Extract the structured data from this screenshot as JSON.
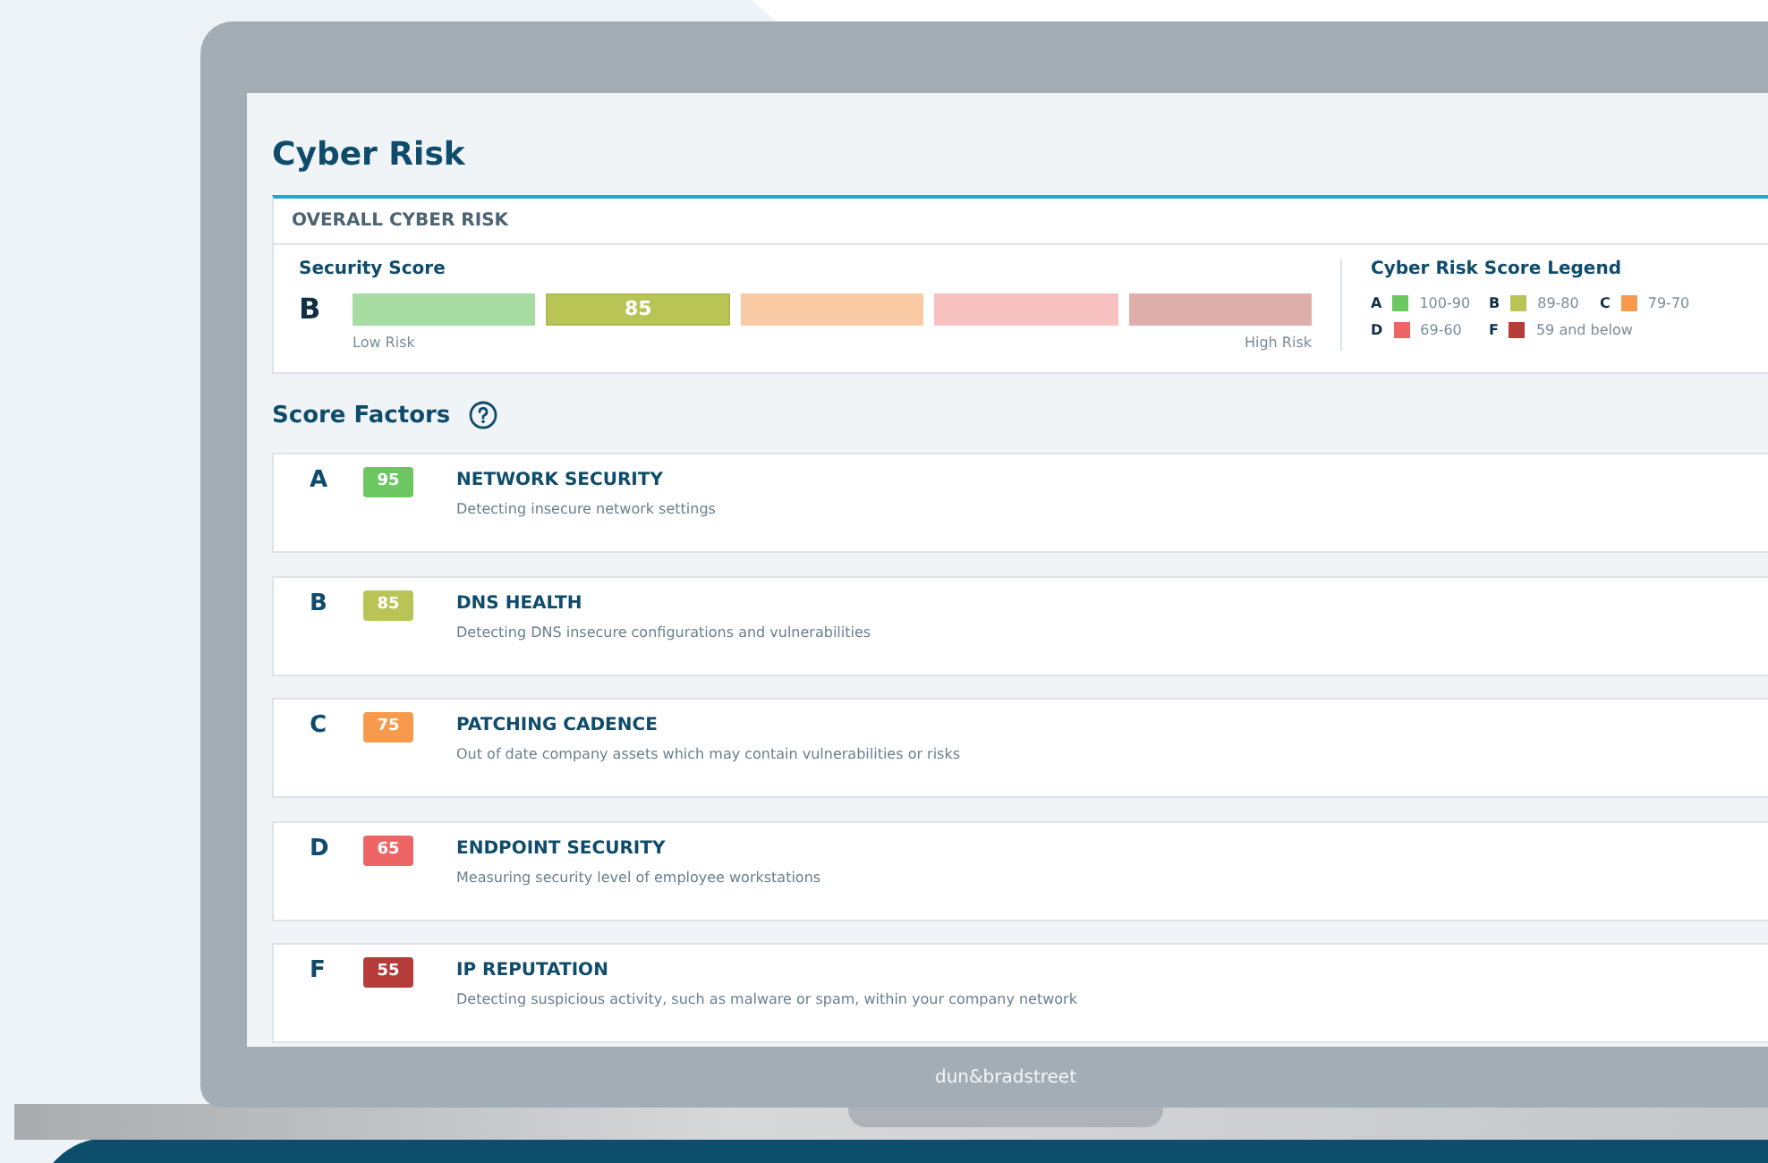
{
  "page": {
    "title": "Cyber Risk"
  },
  "overall": {
    "header": "OVERALL CYBER RISK",
    "score_label": "Security Score",
    "grade": "B",
    "low_label": "Low Risk",
    "high_label": "High Risk",
    "segments": [
      {
        "color": "#a6dca2",
        "selected": false
      },
      {
        "color": "#b8c456",
        "selected": true,
        "value": "85"
      },
      {
        "color": "#facaa4",
        "selected": false
      },
      {
        "color": "#f7c1c0",
        "selected": false
      },
      {
        "color": "#deaeab",
        "selected": false
      }
    ]
  },
  "legend": {
    "title": "Cyber Risk Score Legend",
    "items": [
      {
        "grade": "A",
        "color": "#6cc763",
        "range": "100-90"
      },
      {
        "grade": "B",
        "color": "#b8c456",
        "range": "89-80"
      },
      {
        "grade": "C",
        "color": "#f79a4c",
        "range": "79-70"
      },
      {
        "grade": "D",
        "color": "#ed6564",
        "range": "69-60"
      },
      {
        "grade": "F",
        "color": "#b53c39",
        "range": "59 and below"
      }
    ]
  },
  "factors_title": "Score Factors",
  "factors": [
    {
      "grade": "A",
      "score": "95",
      "color": "#6cc763",
      "name": "NETWORK SECURITY",
      "description": "Detecting insecure network settings"
    },
    {
      "grade": "B",
      "score": "85",
      "color": "#b8c456",
      "name": "DNS HEALTH",
      "description": "Detecting DNS insecure configurations and vulnerabilities"
    },
    {
      "grade": "C",
      "score": "75",
      "color": "#f79a4c",
      "name": "PATCHING CADENCE",
      "description": "Out of date company assets which may contain vulnerabilities or risks"
    },
    {
      "grade": "D",
      "score": "65",
      "color": "#ed6564",
      "name": "ENDPOINT SECURITY",
      "description": "Measuring security level of employee workstations"
    },
    {
      "grade": "F",
      "score": "55",
      "color": "#b53c39",
      "name": "IP REPUTATION",
      "description": "Detecting suspicious activity, such as malware or spam, within your company network"
    }
  ],
  "laptop": {
    "logo": "dun&bradstreet"
  }
}
